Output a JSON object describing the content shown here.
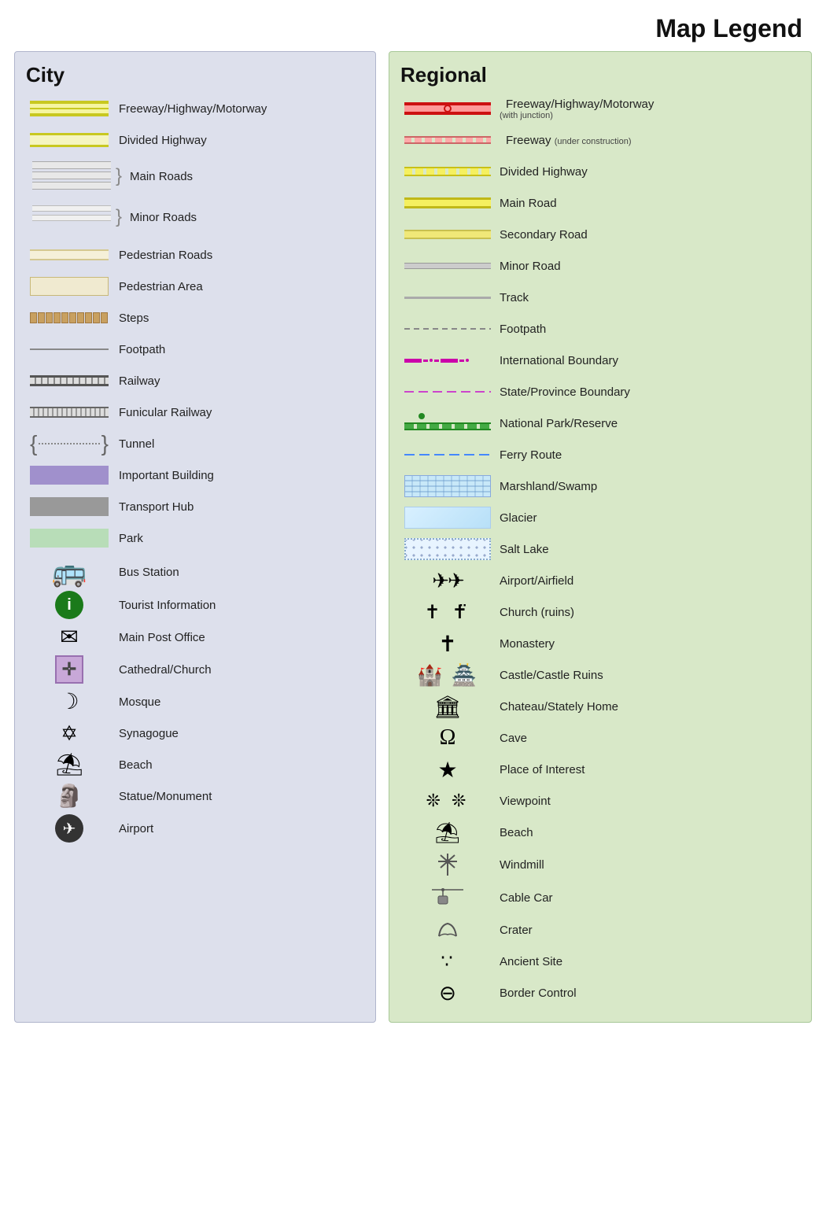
{
  "title": "Map Legend",
  "city": {
    "heading": "City",
    "items": [
      {
        "id": "fwy-hwy",
        "label": "Freeway/Highway/Motorway",
        "type": "road-fwy"
      },
      {
        "id": "div-hwy",
        "label": "Divided Highway",
        "type": "road-divided"
      },
      {
        "id": "main-roads",
        "label": "Main Roads",
        "type": "road-main"
      },
      {
        "id": "minor-roads",
        "label": "Minor Roads",
        "type": "road-minor"
      },
      {
        "id": "ped-roads",
        "label": "Pedestrian Roads",
        "type": "road-pedestrian"
      },
      {
        "id": "ped-area",
        "label": "Pedestrian Area",
        "type": "road-ped-area"
      },
      {
        "id": "steps",
        "label": "Steps",
        "type": "steps"
      },
      {
        "id": "footpath",
        "label": "Footpath",
        "type": "footpath"
      },
      {
        "id": "railway",
        "label": "Railway",
        "type": "railway"
      },
      {
        "id": "funicular",
        "label": "Funicular Railway",
        "type": "funicular"
      },
      {
        "id": "tunnel",
        "label": "Tunnel",
        "type": "tunnel"
      },
      {
        "id": "important-building",
        "label": "Important Building",
        "type": "important-building"
      },
      {
        "id": "transport-hub",
        "label": "Transport Hub",
        "type": "transport-hub"
      },
      {
        "id": "park",
        "label": "Park",
        "type": "park"
      },
      {
        "id": "bus-station",
        "label": "Bus Station",
        "icon": "🚌"
      },
      {
        "id": "tourist-info",
        "label": "Tourist Information",
        "icon": "ℹ️",
        "icon_styled": true
      },
      {
        "id": "post-office",
        "label": "Main Post Office",
        "icon": "✉"
      },
      {
        "id": "cathedral",
        "label": "Cathedral/Church",
        "icon": "✛",
        "icon_styled": true,
        "icon_bg": true
      },
      {
        "id": "mosque",
        "label": "Mosque",
        "icon": "☽"
      },
      {
        "id": "synagogue",
        "label": "Synagogue",
        "icon": "✡"
      },
      {
        "id": "beach",
        "label": "Beach",
        "icon": "⛱"
      },
      {
        "id": "statue",
        "label": "Statue/Monument",
        "icon": "🗿"
      },
      {
        "id": "airport",
        "label": "Airport",
        "icon": "✈",
        "icon_styled": true,
        "icon_circle": true
      }
    ]
  },
  "regional": {
    "heading": "Regional",
    "items": [
      {
        "id": "reg-fwy",
        "label": "Freeway/Highway/Motorway",
        "sublabel": "(with junction)",
        "type": "reg-fwy"
      },
      {
        "id": "reg-fwy-con",
        "label": "Freeway",
        "sublabel": "(under construction)",
        "type": "reg-fwy-con"
      },
      {
        "id": "reg-div",
        "label": "Divided Highway",
        "type": "reg-divided"
      },
      {
        "id": "reg-main",
        "label": "Main Road",
        "type": "reg-main"
      },
      {
        "id": "reg-sec",
        "label": "Secondary Road",
        "type": "reg-secondary"
      },
      {
        "id": "reg-minor",
        "label": "Minor Road",
        "type": "reg-minor"
      },
      {
        "id": "reg-track",
        "label": "Track",
        "type": "reg-track"
      },
      {
        "id": "reg-footpath",
        "label": "Footpath",
        "type": "reg-footpath"
      },
      {
        "id": "reg-intl-boundary",
        "label": "International Boundary",
        "type": "reg-intl-boundary"
      },
      {
        "id": "reg-state-boundary",
        "label": "State/Province Boundary",
        "type": "reg-state-boundary"
      },
      {
        "id": "reg-natpark",
        "label": "National Park/Reserve",
        "type": "reg-natpark"
      },
      {
        "id": "reg-ferry",
        "label": "Ferry Route",
        "type": "reg-ferry"
      },
      {
        "id": "reg-marshland",
        "label": "Marshland/Swamp",
        "type": "reg-marshland"
      },
      {
        "id": "reg-glacier",
        "label": "Glacier",
        "type": "reg-glacier"
      },
      {
        "id": "reg-salt-lake",
        "label": "Salt Lake",
        "type": "reg-salt-lake"
      },
      {
        "id": "reg-airport",
        "label": "Airport/Airfield",
        "icon": "✈✈"
      },
      {
        "id": "reg-church",
        "label": "Church (ruins)",
        "icon": "✝ ✝̈"
      },
      {
        "id": "reg-monastery",
        "label": "Monastery",
        "icon": "✝"
      },
      {
        "id": "reg-castle",
        "label": "Castle/Castle Ruins",
        "icon": "🏰 🏯"
      },
      {
        "id": "reg-chateau",
        "label": "Chateau/Stately Home",
        "icon": "🏛"
      },
      {
        "id": "reg-cave",
        "label": "Cave",
        "icon": "Ω"
      },
      {
        "id": "reg-interest",
        "label": "Place of Interest",
        "icon": "★"
      },
      {
        "id": "reg-viewpoint",
        "label": "Viewpoint",
        "icon": "❊ ❊"
      },
      {
        "id": "reg-beach",
        "label": "Beach",
        "icon": "⛱"
      },
      {
        "id": "reg-windmill",
        "label": "Windmill",
        "icon": "⚙"
      },
      {
        "id": "reg-cable-car",
        "label": "Cable Car",
        "icon": "🚡"
      },
      {
        "id": "reg-crater",
        "label": "Crater",
        "icon": "⊃"
      },
      {
        "id": "reg-ancient",
        "label": "Ancient Site",
        "icon": "∵"
      },
      {
        "id": "reg-border",
        "label": "Border Control",
        "icon": "⊖"
      }
    ]
  }
}
